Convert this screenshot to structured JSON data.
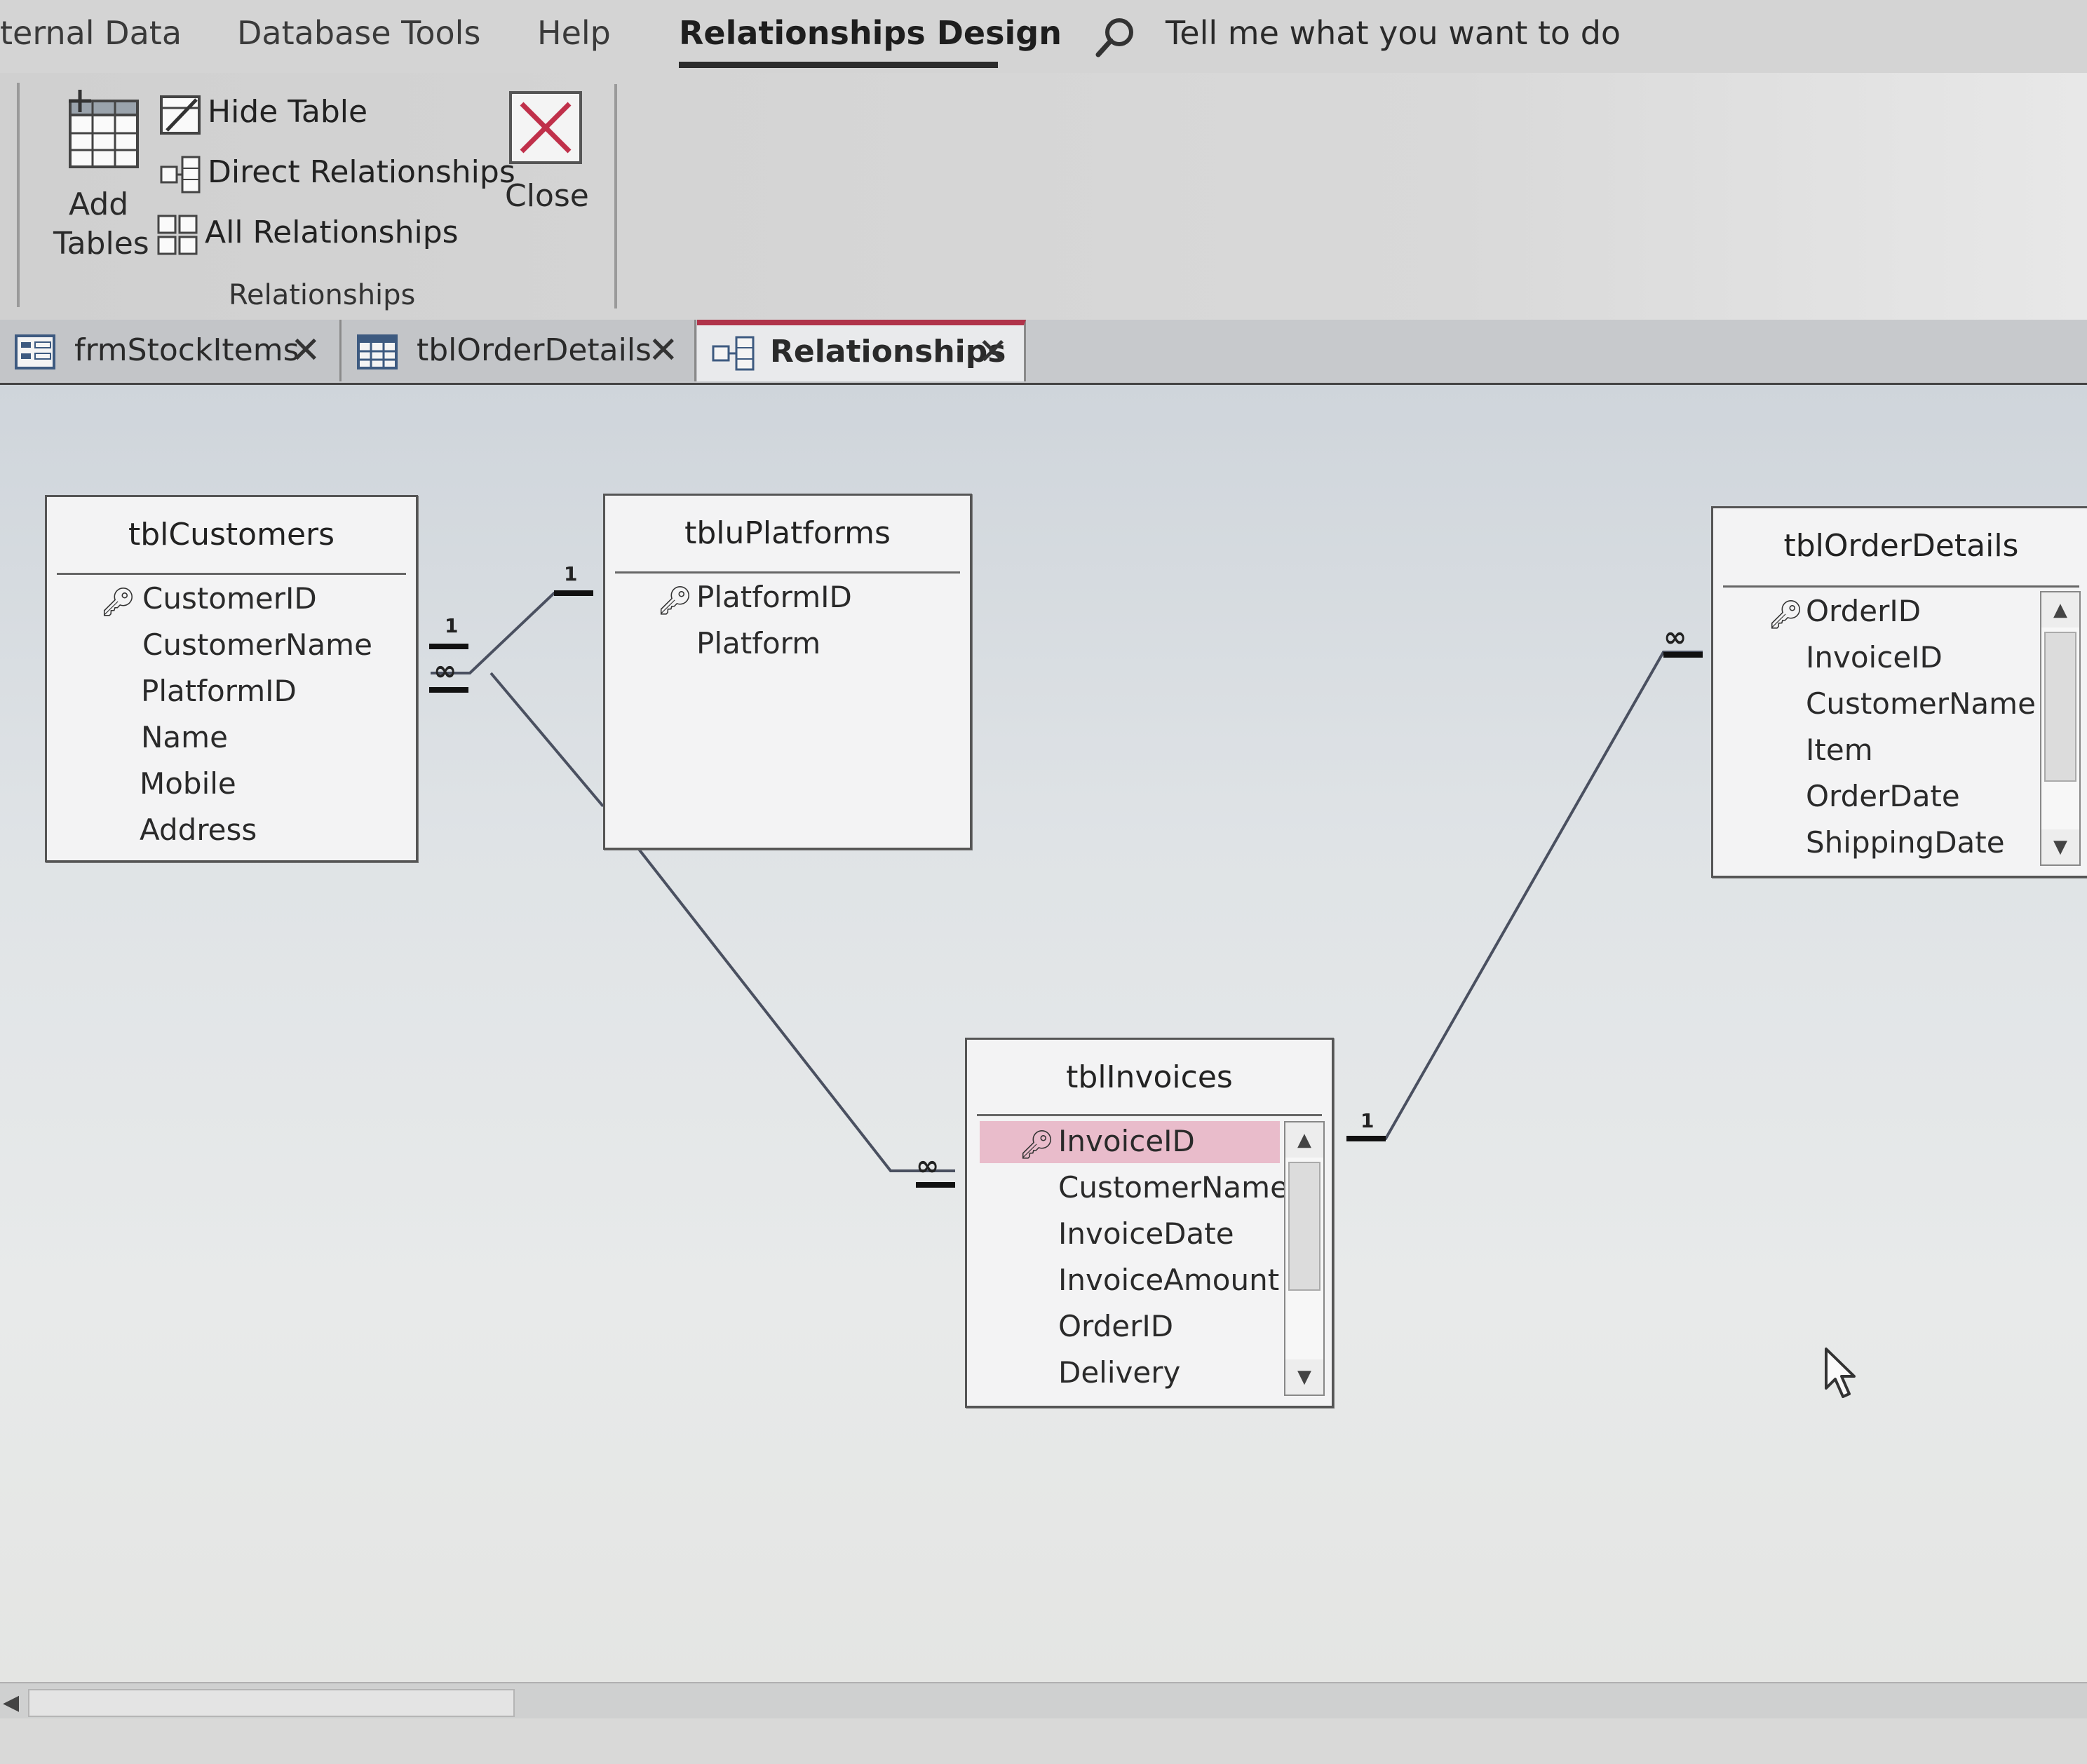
{
  "ribbon": {
    "tabs": [
      "ternal Data",
      "Database Tools",
      "Help",
      "Relationships Design"
    ],
    "active_tab": "Relationships Design",
    "tell_me": "Tell me what you want to do",
    "buttons": {
      "add_tables_line1": "Add",
      "add_tables_line2": "Tables",
      "hide_table": "Hide Table",
      "direct_relationships": "Direct Relationships",
      "all_relationships": "All Relationships",
      "close": "Close"
    },
    "group_label": "Relationships"
  },
  "doc_tabs": [
    {
      "label": "frmStockItems",
      "icon": "form-icon"
    },
    {
      "label": "tblOrderDetails",
      "icon": "table-icon"
    },
    {
      "label": "Relationships",
      "icon": "relationships-icon",
      "active": true
    }
  ],
  "tables": {
    "tblCustomers": {
      "title": "tblCustomers",
      "fields": [
        "CustomerID",
        "CustomerName",
        "PlatformID",
        "Name",
        "Mobile",
        "Address"
      ],
      "primary_key": "CustomerID"
    },
    "tbluPlatforms": {
      "title": "tbluPlatforms",
      "fields": [
        "PlatformID",
        "Platform"
      ],
      "primary_key": "PlatformID"
    },
    "tblOrderDetails": {
      "title": "tblOrderDetails",
      "fields": [
        "OrderID",
        "InvoiceID",
        "CustomerName",
        "Item",
        "OrderDate",
        "ShippingDate"
      ],
      "primary_key": "OrderID"
    },
    "tblInvoices": {
      "title": "tblInvoices",
      "fields": [
        "InvoiceID",
        "CustomerName",
        "InvoiceDate",
        "InvoiceAmount",
        "OrderID",
        "Delivery"
      ],
      "primary_key": "InvoiceID",
      "selected_field": "InvoiceID"
    }
  },
  "relationships": {
    "one": "1",
    "many": "∞"
  },
  "colors": {
    "selected_field": "#e9bccb",
    "active_tab_accent": "#b0334a",
    "close_x": "#c0304a"
  }
}
